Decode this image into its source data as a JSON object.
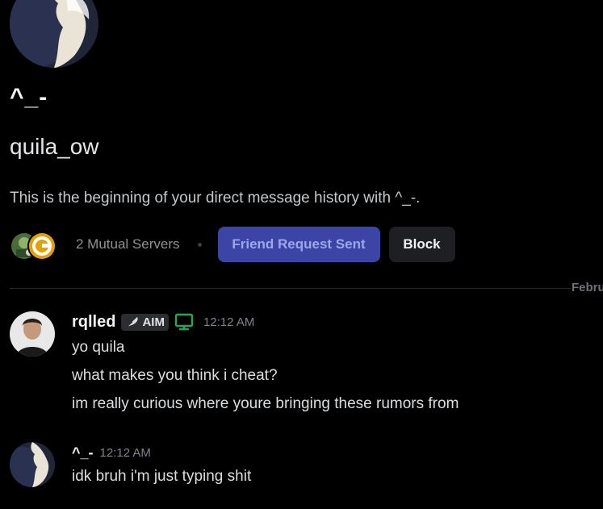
{
  "profile": {
    "display_name": "^_-",
    "username": "quila_ow",
    "intro_text": "This is the beginning of your direct message history with ^_-."
  },
  "actions": {
    "mutual_servers": "2 Mutual Servers",
    "friend_request_label": "Friend Request Sent",
    "block_label": "Block"
  },
  "divider": {
    "date_label": "Febru"
  },
  "messages": [
    {
      "author": "rqlled",
      "tag": "AIM",
      "status_icon": "desktop-icon",
      "time": "12:12 AM",
      "lines": [
        "yo quila",
        "what makes you think i cheat?",
        "im really curious where youre bringing these rumors from"
      ]
    },
    {
      "author": "^_-",
      "time": "12:12 AM",
      "lines": [
        "idk bruh i'm just typing shit"
      ]
    }
  ],
  "colors": {
    "background": "#000000",
    "friend_button_bg": "#3c45a5",
    "block_button_bg": "#1e1f22",
    "online_green": "#23a55a"
  }
}
